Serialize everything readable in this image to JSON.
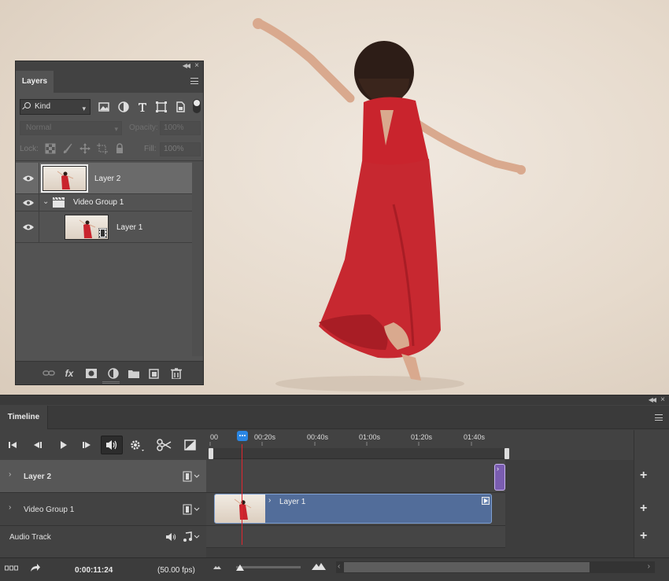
{
  "layers_panel": {
    "tab_label": "Layers",
    "filter_kind": "Kind",
    "blend_mode": "Normal",
    "opacity_label": "Opacity:",
    "opacity_value": "100%",
    "lock_label": "Lock:",
    "fill_label": "Fill:",
    "fill_value": "100%",
    "layers": [
      {
        "name": "Layer 2",
        "selected": true
      },
      {
        "name": "Video Group 1",
        "type": "group"
      },
      {
        "name": "Layer 1",
        "type": "video"
      }
    ],
    "footer_fx": "fx"
  },
  "timeline": {
    "tab_label": "Timeline",
    "ruler_labels": [
      "00",
      "00:20s",
      "00:40s",
      "01:00s",
      "01:20s",
      "01:40s"
    ],
    "tracks": [
      {
        "name": "Layer 2"
      },
      {
        "name": "Video Group 1"
      },
      {
        "name": "Audio Track"
      }
    ],
    "clip_label": "Layer 1",
    "current_time": "0:00:11:24",
    "fps": "(50.00 fps)"
  },
  "colors": {
    "panel_bg": "#535353",
    "clip_video": "#526d9a",
    "clip_purple": "#7a5db0",
    "playhead": "#e0262f",
    "playhead_handle": "#2a86e3"
  }
}
